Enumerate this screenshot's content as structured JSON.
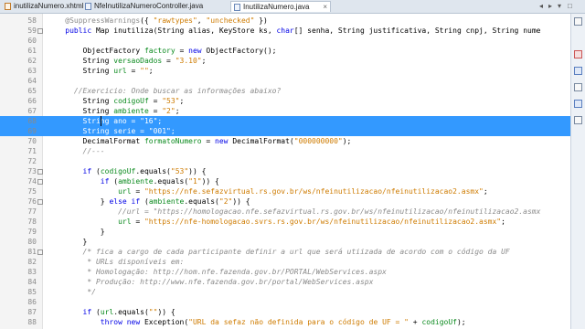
{
  "tabs": [
    {
      "label": "inutilizaNumero.xhtml",
      "icon": "html-file-icon",
      "active": false
    },
    {
      "label": "NfeInutilizaNumeroController.java",
      "icon": "java-file-icon",
      "active": false
    },
    {
      "label": "InutilizaNumero.java",
      "icon": "java-file-icon",
      "active": true
    }
  ],
  "tab_close_glyph": "×",
  "tab_controls": {
    "left": "◂",
    "right": "▸",
    "list": "▾",
    "maximize": "□"
  },
  "lines": [
    {
      "n": "58",
      "t": "    @SuppressWarnings({ \"rawtypes\", \"unchecked\" })"
    },
    {
      "n": "59",
      "t": "    public Map inutiliza(String alias, KeyStore ks, char[] senha, String justificativa, String cnpj, String nume"
    },
    {
      "n": "60",
      "t": ""
    },
    {
      "n": "61",
      "t": "        ObjectFactory factory = new ObjectFactory();"
    },
    {
      "n": "62",
      "t": "        String versaoDados = \"3.10\";"
    },
    {
      "n": "63",
      "t": "        String url = \"\";"
    },
    {
      "n": "64",
      "t": ""
    },
    {
      "n": "65",
      "t": "      //Exercicio: Onde buscar as informações abaixo?"
    },
    {
      "n": "66",
      "t": "        String codigoUf = \"53\";"
    },
    {
      "n": "67",
      "t": "        String ambiente = \"2\";"
    },
    {
      "n": "68",
      "t": "        String ano = \"16\";"
    },
    {
      "n": "69",
      "t": "        String serie = \"001\";"
    },
    {
      "n": "70",
      "t": "        DecimalFormat formatoNumero = new DecimalFormat(\"000000000\");"
    },
    {
      "n": "71",
      "t": "        //---"
    },
    {
      "n": "72",
      "t": ""
    },
    {
      "n": "73",
      "t": "        if (codigoUf.equals(\"53\")) {"
    },
    {
      "n": "74",
      "t": "            if (ambiente.equals(\"1\")) {"
    },
    {
      "n": "75",
      "t": "                url = \"https://nfe.sefazvirtual.rs.gov.br/ws/nfeinutilizacao/nfeinutilizacao2.asmx\";"
    },
    {
      "n": "76",
      "t": "            } else if (ambiente.equals(\"2\")) {"
    },
    {
      "n": "77",
      "t": "                //url = \"https://homologacao.nfe.sefazvirtual.rs.gov.br/ws/nfeinutilizacao/nfeinutilizacao2.asmx"
    },
    {
      "n": "78",
      "t": "                url = \"https://nfe-homologacao.svrs.rs.gov.br/ws/nfeinutilizacao/nfeinutilizacao2.asmx\";"
    },
    {
      "n": "79",
      "t": "            }"
    },
    {
      "n": "80",
      "t": "        }"
    },
    {
      "n": "81",
      "t": "        /* fica a cargo de cada participante definir a url que será utiizada de acordo com o código da UF"
    },
    {
      "n": "82",
      "t": "         * URLs disponíveis em:"
    },
    {
      "n": "83",
      "t": "         * Homologação: http://hom.nfe.fazenda.gov.br/PORTAL/WebServices.aspx"
    },
    {
      "n": "84",
      "t": "         * Produção: http://www.nfe.fazenda.gov.br/portal/WebServices.aspx"
    },
    {
      "n": "85",
      "t": "         */"
    },
    {
      "n": "86",
      "t": ""
    },
    {
      "n": "87",
      "t": "        if (url.equals(\"\")) {"
    },
    {
      "n": "88",
      "t": "            throw new Exception(\"URL da sefaz não definida para o código de UF = \" + codigoUf);"
    },
    {
      "n": "89",
      "t": "        }"
    }
  ],
  "selected_lines": [
    "68",
    "69"
  ],
  "caret_line": "68",
  "colors": {
    "selection": "#3399ff",
    "keyword": "#0000e6",
    "string": "#ce7b00",
    "comment": "#8a8a8a",
    "field": "#0b8a1e"
  }
}
